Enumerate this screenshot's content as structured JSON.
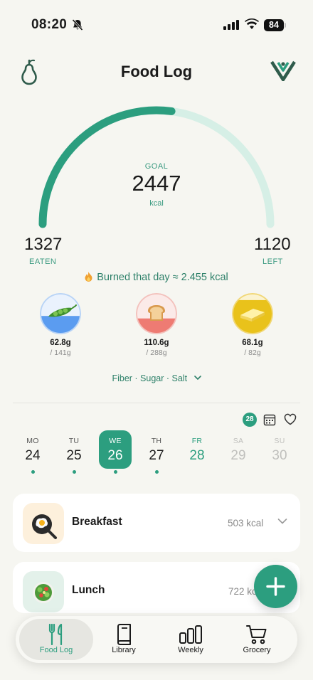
{
  "status": {
    "time": "08:20",
    "battery": "84"
  },
  "header": {
    "title": "Food Log"
  },
  "summary": {
    "goal_label": "GOAL",
    "goal_value": "2447",
    "goal_unit": "kcal",
    "eaten_value": "1327",
    "eaten_label": "EATEN",
    "left_value": "1120",
    "left_label": "LEFT",
    "progress_fraction": 0.542,
    "burned_text": "Burned that day ≈ 2.455 kcal"
  },
  "macros": [
    {
      "name": "protein",
      "icon": "pea-pod-icon",
      "value": "62.8g",
      "max": "/ 141g",
      "fill": 0.445,
      "color": "#5b9cf0"
    },
    {
      "name": "carbs",
      "icon": "bread-icon",
      "value": "110.6g",
      "max": "/ 288g",
      "fill": 0.384,
      "color": "#ee7b73"
    },
    {
      "name": "fat",
      "icon": "butter-icon",
      "value": "68.1g",
      "max": "/ 82g",
      "fill": 0.83,
      "color": "#e9c21b"
    }
  ],
  "micros_link": "Fiber · Sugar · Salt",
  "week": {
    "badge": "28",
    "days": [
      {
        "name": "MO",
        "date": "24",
        "state": "past",
        "logged": true
      },
      {
        "name": "TU",
        "date": "25",
        "state": "past",
        "logged": true
      },
      {
        "name": "WE",
        "date": "26",
        "state": "selected",
        "logged": true
      },
      {
        "name": "TH",
        "date": "27",
        "state": "past",
        "logged": true
      },
      {
        "name": "FR",
        "date": "28",
        "state": "today",
        "logged": false
      },
      {
        "name": "SA",
        "date": "29",
        "state": "future",
        "logged": false
      },
      {
        "name": "SU",
        "date": "30",
        "state": "future",
        "logged": false
      }
    ]
  },
  "meals": [
    {
      "name": "Breakfast",
      "kcal": "503 kcal",
      "icon": "fried-egg-pan-icon"
    },
    {
      "name": "Lunch",
      "kcal": "722 kcal",
      "icon": "salad-bowl-icon"
    }
  ],
  "tabs": [
    {
      "label": "Food Log",
      "icon": "fork-knife-icon",
      "active": true
    },
    {
      "label": "Library",
      "icon": "book-icon",
      "active": false
    },
    {
      "label": "Weekly",
      "icon": "bar-chart-icon",
      "active": false
    },
    {
      "label": "Grocery",
      "icon": "cart-icon",
      "active": false
    }
  ],
  "colors": {
    "accent": "#2c9e7f",
    "accent_light": "#d6efe6",
    "background": "#f6f6f1"
  }
}
